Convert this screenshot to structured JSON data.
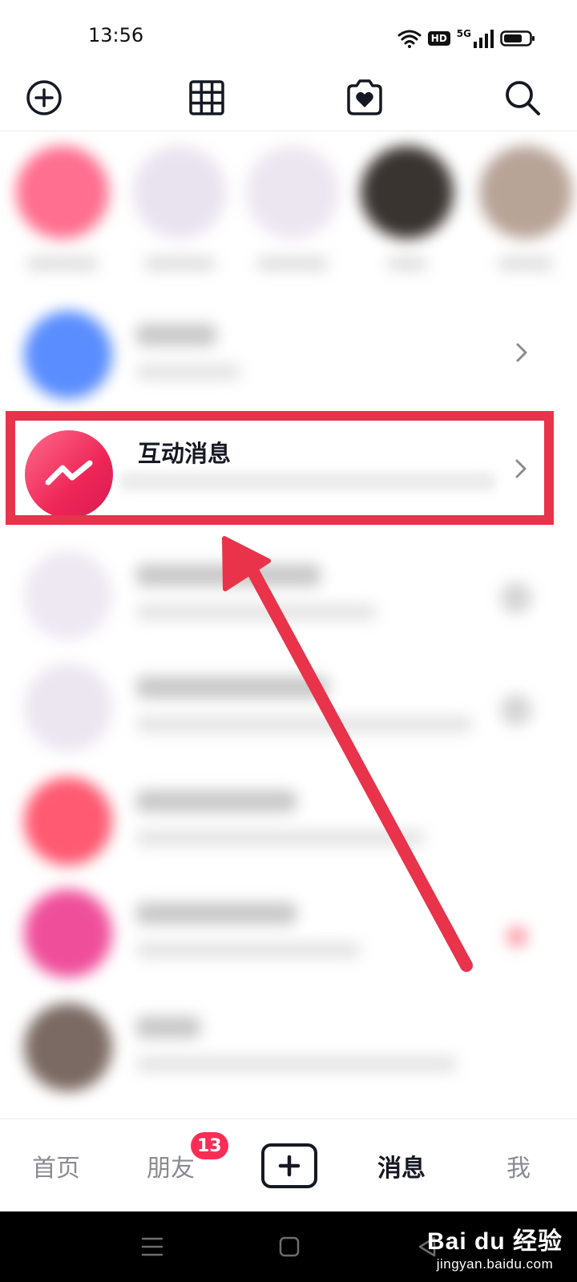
{
  "status_bar": {
    "time": "13:56",
    "hd_label": "HD",
    "network_label": "5G"
  },
  "top_bar": {
    "icons": [
      "add-circle-icon",
      "grid-icon",
      "camera-heart-icon",
      "search-icon"
    ]
  },
  "highlighted_item": {
    "title": "互动消息"
  },
  "tab_bar": {
    "home": "首页",
    "friends": "朋友",
    "friends_badge": "13",
    "messages": "消息",
    "me": "我"
  },
  "watermark": {
    "brand": "Bai du 经验",
    "url": "jingyan.baidu.com"
  },
  "colors": {
    "accent": "#fe2c55",
    "highlight_border": "#e8334a",
    "avatar_gradient_start": "#ff6a8a",
    "avatar_gradient_end": "#d81a52"
  }
}
